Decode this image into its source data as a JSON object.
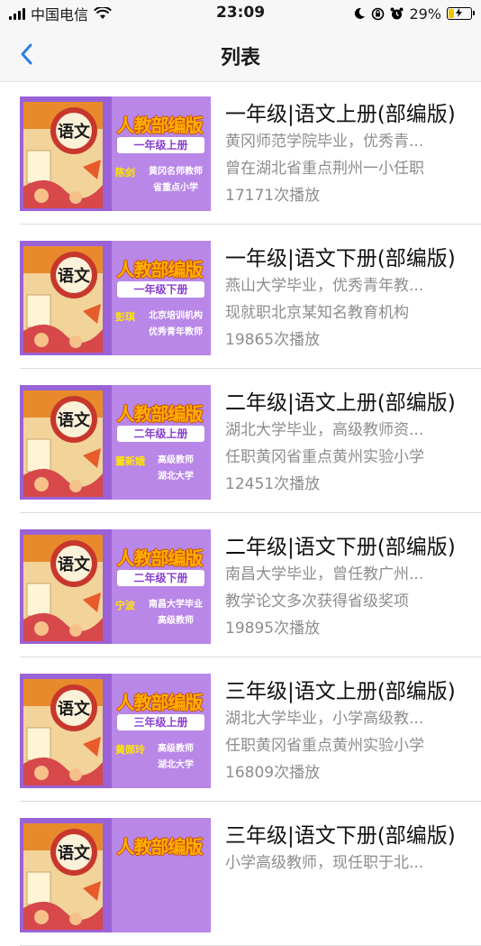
{
  "status": {
    "carrier": "中国电信",
    "time": "23:09",
    "battery": "29%",
    "battery_level": 0.29
  },
  "nav": {
    "title": "列表"
  },
  "items": [
    {
      "banner": "人教部编版",
      "grade": "一年级上册",
      "teacher": "陈剑",
      "desc1": "黄冈名师教师",
      "desc2": "省重点小学",
      "title": "一年级|语文上册(部编版)",
      "line1": "黄冈师范学院毕业，优秀青...",
      "line2": "曾在湖北省重点荆州一小任职",
      "plays": "17171次播放"
    },
    {
      "banner": "人教部编版",
      "grade": "一年级下册",
      "teacher": "彭琪",
      "desc1": "北京培训机构",
      "desc2": "优秀青年教师",
      "title": "一年级|语文下册(部编版)",
      "line1": "燕山大学毕业，优秀青年教...",
      "line2": "现就职北京某知名教育机构",
      "plays": "19865次播放"
    },
    {
      "banner": "人教部编版",
      "grade": "二年级上册",
      "teacher": "董新娥",
      "desc1": "高级教师",
      "desc2": "湖北大学",
      "title": "二年级|语文上册(部编版)",
      "line1": "湖北大学毕业，高级教师资...",
      "line2": "任职黄冈省重点黄州实验小学",
      "plays": "12451次播放"
    },
    {
      "banner": "人教部编版",
      "grade": "二年级下册",
      "teacher": "宁波",
      "desc1": "南昌大学毕业",
      "desc2": "高级教师",
      "title": "二年级|语文下册(部编版)",
      "line1": "南昌大学毕业，曾任教广州...",
      "line2": "教学论文多次获得省级奖项",
      "plays": "19895次播放"
    },
    {
      "banner": "人教部编版",
      "grade": "三年级上册",
      "teacher": "黄郧玲",
      "desc1": "高级教师",
      "desc2": "湖北大学",
      "title": "三年级|语文上册(部编版)",
      "line1": "湖北大学毕业，小学高级教...",
      "line2": "任职黄冈省重点黄州实验小学",
      "plays": "16809次播放"
    },
    {
      "banner": "人教部编版",
      "grade": "",
      "teacher": "",
      "desc1": "",
      "desc2": "",
      "title": "三年级|语文下册(部编版)",
      "line1": "小学高级教师，现任职于北...",
      "line2": "",
      "plays": ""
    }
  ]
}
